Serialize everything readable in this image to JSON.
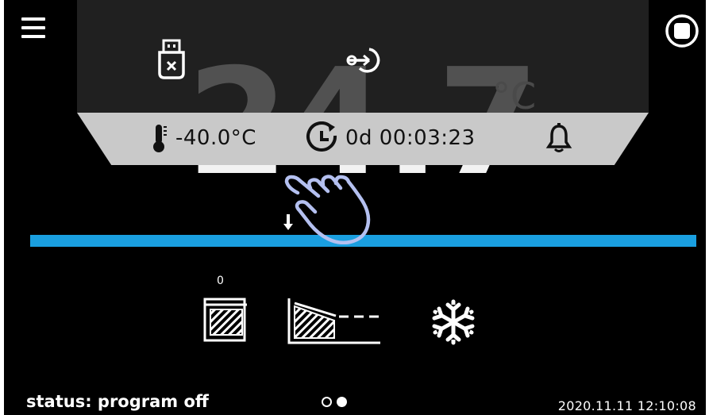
{
  "main": {
    "temperature": "24.7",
    "unit": "°C",
    "segment_count": "0"
  },
  "quick_menu": {
    "icons": [
      "usb-eject-icon",
      "key-login-icon"
    ]
  },
  "info_bar": {
    "setpoint": "-40.0°C",
    "timer": "0d 00:03:23",
    "icons": [
      "thermometer-icon",
      "clock-timer-icon",
      "bell-icon"
    ]
  },
  "footer": {
    "status": "status: program off",
    "datetime": "2020.11.11  12:10:08",
    "page_count": 2,
    "active_page": 2
  },
  "colors": {
    "background": "#000000",
    "progress_bar": "#1a9fe0",
    "info_bar": "#c9c9c9",
    "hand_gesture": "#b4c0f0"
  }
}
